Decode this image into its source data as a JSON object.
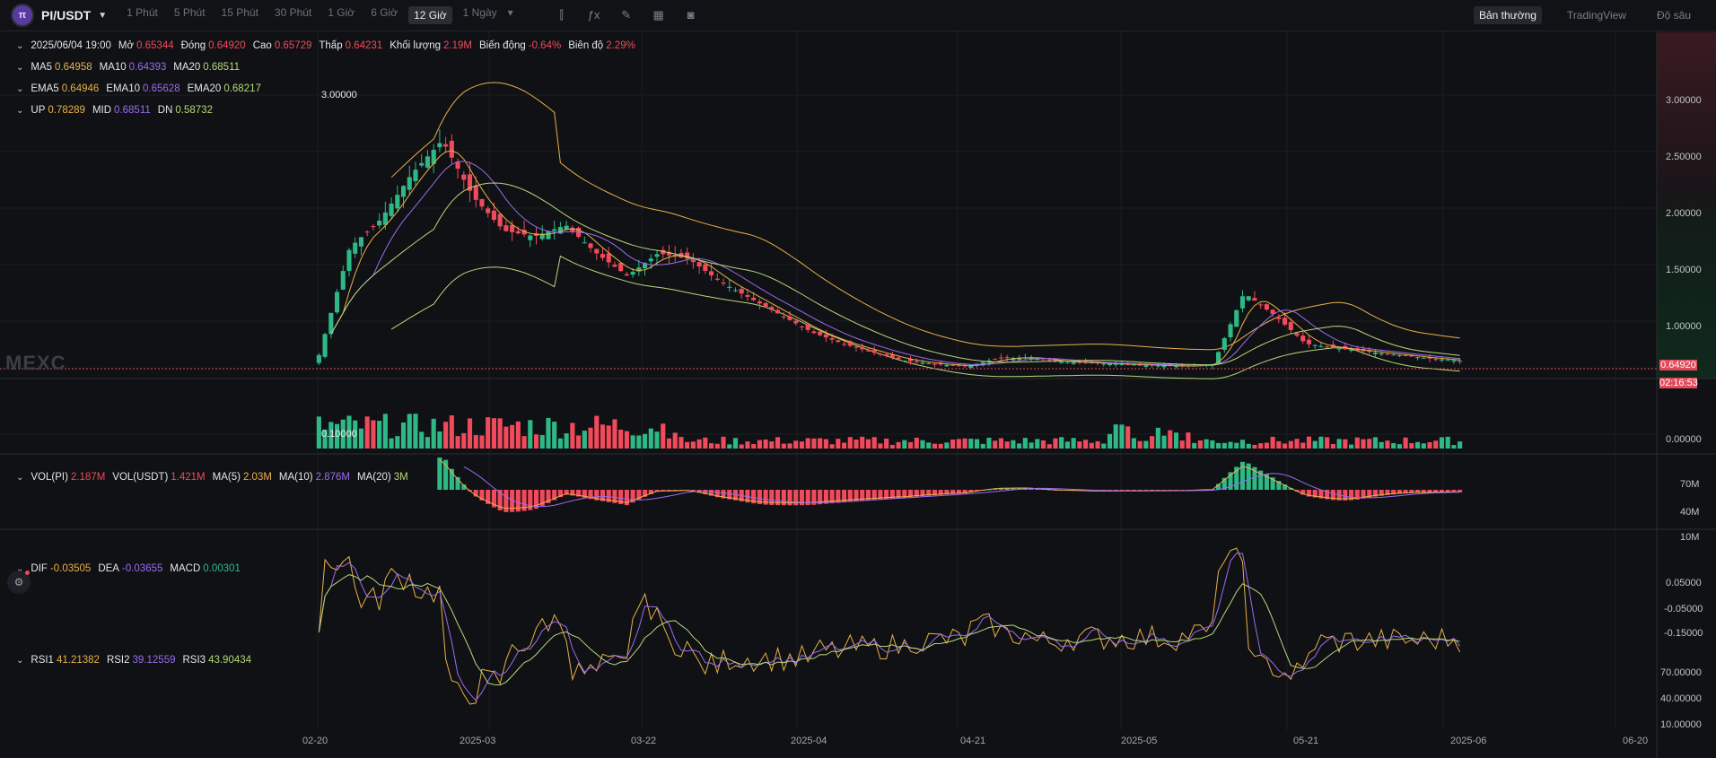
{
  "header": {
    "pair": "PI/USDT",
    "intervals": [
      "1 Phút",
      "5 Phút",
      "15 Phút",
      "30 Phút",
      "1 Giờ",
      "6 Giờ",
      "12 Giờ",
      "1 Ngày"
    ],
    "active_interval": "12 Giờ",
    "views": [
      "Bản thường",
      "TradingView",
      "Độ sâu"
    ],
    "active_view": "Bản thường"
  },
  "ohlc": {
    "time": "2025/06/04 19:00",
    "open_label": "Mở",
    "open": "0.65344",
    "close_label": "Đóng",
    "close": "0.64920",
    "high_label": "Cao",
    "high": "0.65729",
    "low_label": "Thấp",
    "low": "0.64231",
    "volume_label": "Khối lượng",
    "volume": "2.19M",
    "change_label": "Biến động",
    "change": "-0.64%",
    "amplitude_label": "Biên độ",
    "amplitude": "2.29%"
  },
  "ma": {
    "ma5_label": "MA5",
    "ma5": "0.64958",
    "ma10_label": "MA10",
    "ma10": "0.64393",
    "ma20_label": "MA20",
    "ma20": "0.68511"
  },
  "ema": {
    "ema5_label": "EMA5",
    "ema5": "0.64946",
    "ema10_label": "EMA10",
    "ema10": "0.65628",
    "ema20_label": "EMA20",
    "ema20": "0.68217"
  },
  "boll": {
    "up_label": "UP",
    "up": "0.78289",
    "mid_label": "MID",
    "mid": "0.68511",
    "dn_label": "DN",
    "dn": "0.58732"
  },
  "main_axis": {
    "ticks": [
      "3.00000",
      "2.50000",
      "2.00000",
      "1.50000",
      "1.00000",
      "0.00000"
    ],
    "high_marker": "3.00000",
    "low_marker": "0.10000"
  },
  "price_badge": {
    "price": "0.64920",
    "countdown": "02:16:53"
  },
  "watermark": "MEXC",
  "volume_panel": {
    "vol_pi_label": "VOL(PI)",
    "vol_pi": "2.187M",
    "vol_usdt_label": "VOL(USDT)",
    "vol_usdt": "1.421M",
    "ma5_label": "MA(5)",
    "ma5": "2.03M",
    "ma10_label": "MA(10)",
    "ma10": "2.876M",
    "ma20_label": "MA(20)",
    "ma20": "3M",
    "ticks": [
      "70M",
      "40M",
      "10M"
    ]
  },
  "macd_panel": {
    "dif_label": "DIF",
    "dif": "-0.03505",
    "dea_label": "DEA",
    "dea": "-0.03655",
    "macd_label": "MACD",
    "macd": "0.00301",
    "ticks": [
      "0.05000",
      "-0.05000",
      "-0.15000"
    ]
  },
  "rsi_panel": {
    "rsi1_label": "RSI1",
    "rsi1": "41.21382",
    "rsi2_label": "RSI2",
    "rsi2": "39.12559",
    "rsi3_label": "RSI3",
    "rsi3": "43.90434",
    "ticks": [
      "70.00000",
      "40.00000",
      "10.00000"
    ]
  },
  "x_axis": [
    "02-20",
    "2025-03",
    "03-22",
    "2025-04",
    "04-21",
    "2025-05",
    "05-21",
    "2025-06",
    "06-20"
  ],
  "colors": {
    "up": "#2eb886",
    "down": "#f04a5c",
    "ma5": "#e8b04a",
    "ma10": "#9a6cf0",
    "ma20": "#b6d77a",
    "background": "#101114"
  },
  "chart_data": {
    "type": "candlestick",
    "series": [
      {
        "name": "close",
        "values": [
          0.7,
          1.65,
          1.9,
          2.3,
          2.6,
          2.1,
          1.8,
          1.75,
          1.85,
          1.6,
          1.4,
          1.6,
          1.55,
          1.35,
          1.2,
          1.05,
          0.9,
          0.8,
          0.72,
          0.65,
          0.62,
          0.6,
          0.67,
          0.68,
          0.64,
          0.63,
          0.62,
          0.61,
          0.6,
          0.62,
          1.25,
          1.05,
          0.8,
          0.76,
          0.73,
          0.7,
          0.67,
          0.6492
        ]
      }
    ],
    "price_range": [
      0.0,
      3.0
    ]
  }
}
